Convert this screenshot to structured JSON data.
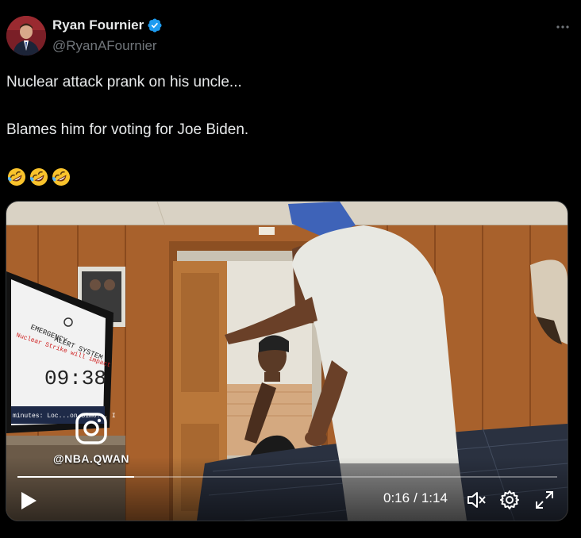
{
  "author": {
    "display_name": "Ryan Fournier",
    "handle": "@RyanAFournier",
    "verified": true
  },
  "tweet": {
    "line1": "Nuclear attack prank on his uncle...",
    "line2": "Blames him for voting for Joe Biden.",
    "emojis": [
      "rolling-on-floor-laughing",
      "rolling-on-floor-laughing",
      "rolling-on-floor-laughing"
    ]
  },
  "video": {
    "watermark": "@NBA.QWAN",
    "current_time": "0:16",
    "separator": "/",
    "duration": "1:14",
    "progress_fraction": 0.216,
    "muted": true,
    "tv_screen": {
      "title_line1": "EMERGENCY",
      "title_line2": "ALERT SYSTEM",
      "alert": "Nuclear Strike will impact",
      "countdown": "09:38",
      "ticker": "minutes: Loc...on Simo... I"
    }
  },
  "colors": {
    "background": "#000000",
    "text_primary": "#e7e9ea",
    "text_secondary": "#71767b",
    "verified_blue": "#1d9bf0",
    "border": "#2f3336"
  }
}
